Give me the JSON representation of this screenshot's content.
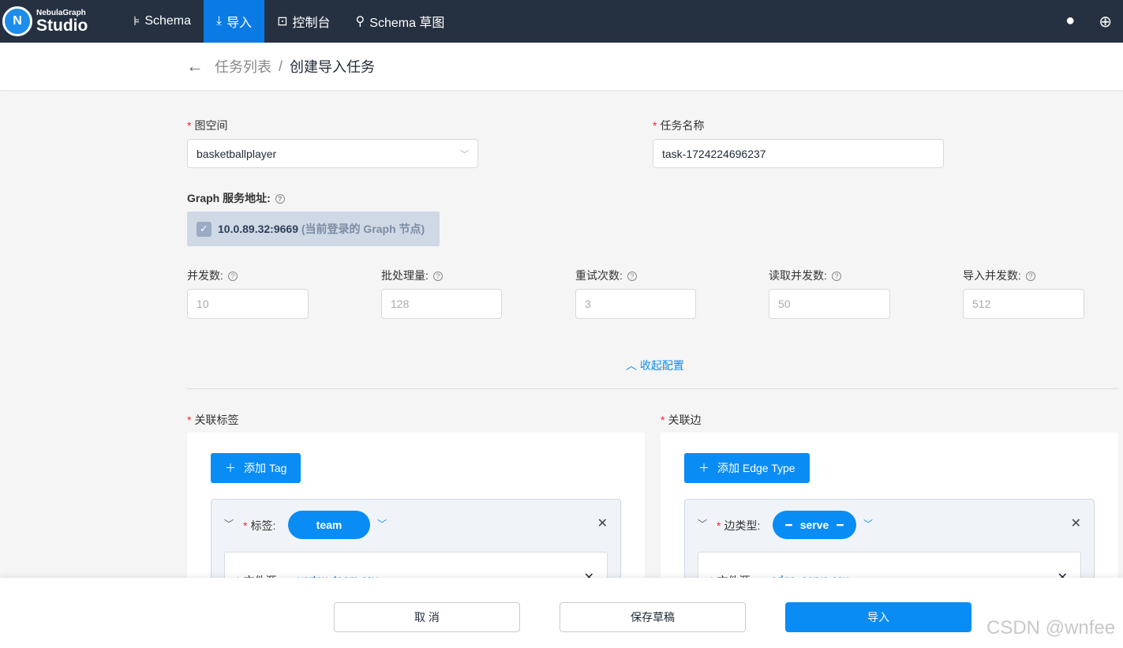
{
  "nav": {
    "logo_small": "NebulaGraph",
    "logo_big": "Studio",
    "items": [
      {
        "label": "Schema",
        "icon": "tree-icon"
      },
      {
        "label": "导入",
        "icon": "import-icon"
      },
      {
        "label": "控制台",
        "icon": "terminal-icon"
      },
      {
        "label": "Schema 草图",
        "icon": "graph-icon"
      }
    ],
    "active": "导入"
  },
  "breadcrumb": {
    "parent": "任务列表",
    "sep": "/",
    "current": "创建导入任务"
  },
  "form": {
    "space_label": "图空间",
    "space_value": "basketballplayer",
    "task_label": "任务名称",
    "task_value": "task-1724224696237",
    "graph_label": "Graph 服务地址:",
    "graph_addr": "10.0.89.32:9669",
    "graph_note": "(当前登录的 Graph 节点)",
    "params": [
      {
        "label": "并发数:",
        "placeholder": "10"
      },
      {
        "label": "批处理量:",
        "placeholder": "128"
      },
      {
        "label": "重试次数:",
        "placeholder": "3"
      },
      {
        "label": "读取并发数:",
        "placeholder": "50"
      },
      {
        "label": "导入并发数:",
        "placeholder": "512"
      }
    ],
    "collapse": "收起配置"
  },
  "tags": {
    "label": "关联标签",
    "add": "添加 Tag",
    "item_label": "标签:",
    "item_value": "team",
    "file_label": "文件源:",
    "file_value": "vertex_team.csv"
  },
  "edges": {
    "label": "关联边",
    "add": "添加 Edge Type",
    "item_label": "边类型:",
    "item_value": "serve",
    "file_label": "文件源:",
    "file_value": "edge_serve.csv"
  },
  "footer": {
    "cancel": "取 消",
    "draft": "保存草稿",
    "import": "导入"
  },
  "watermark": "CSDN @wnfee",
  "colors": {
    "primary": "#0a8cf5",
    "nav_bg": "#253040"
  }
}
